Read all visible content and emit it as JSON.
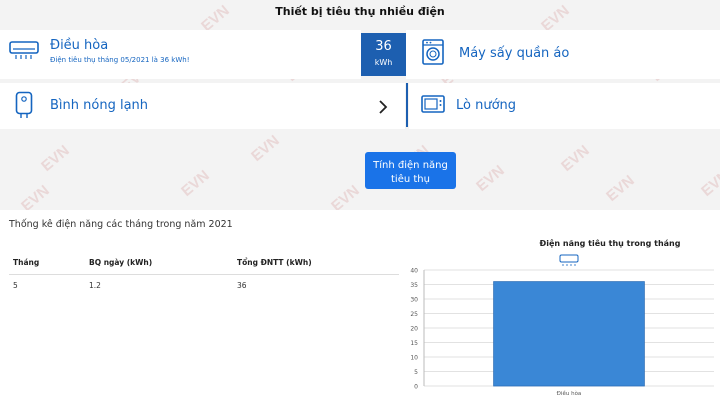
{
  "page": {
    "title": "Thiết bị tiêu thụ nhiều điện",
    "watermark": "EVN"
  },
  "devices": {
    "air_conditioner": {
      "label": "Điều hòa",
      "subtitle": "Điện tiêu thụ tháng 05/2021 là 36 kWh!",
      "value": "36",
      "unit": "kWh",
      "icon": "air-conditioner-icon"
    },
    "dryer": {
      "label": "Máy sấy quần áo",
      "icon": "washing-machine-icon"
    },
    "water_heater": {
      "label": "Bình nóng lạnh",
      "icon": "water-heater-icon"
    },
    "oven": {
      "label": "Lò nướng",
      "icon": "microwave-oven-icon"
    }
  },
  "calc_button": {
    "line1": "Tính điện năng",
    "line2": "tiêu thụ"
  },
  "stats": {
    "title": "Thống kê điện năng các tháng trong năm 2021",
    "columns": [
      "Tháng",
      "BQ ngày (kWh)",
      "Tổng ĐNTT (kWh)"
    ],
    "rows": [
      [
        "5",
        "1.2",
        "36"
      ]
    ]
  },
  "chart_data": {
    "type": "bar",
    "title": "Điện năng tiêu thụ trong tháng",
    "categories": [
      "Điều hòa"
    ],
    "values": [
      36
    ],
    "ylim": [
      0,
      40
    ],
    "yticks": [
      "0",
      "5",
      "10",
      "15",
      "20",
      "25",
      "30",
      "35",
      "40"
    ],
    "bar_color": "#3a87d6",
    "grid": true
  },
  "colors": {
    "accent": "#1d5fb0",
    "button": "#1a73e8",
    "label": "#1565c0"
  }
}
